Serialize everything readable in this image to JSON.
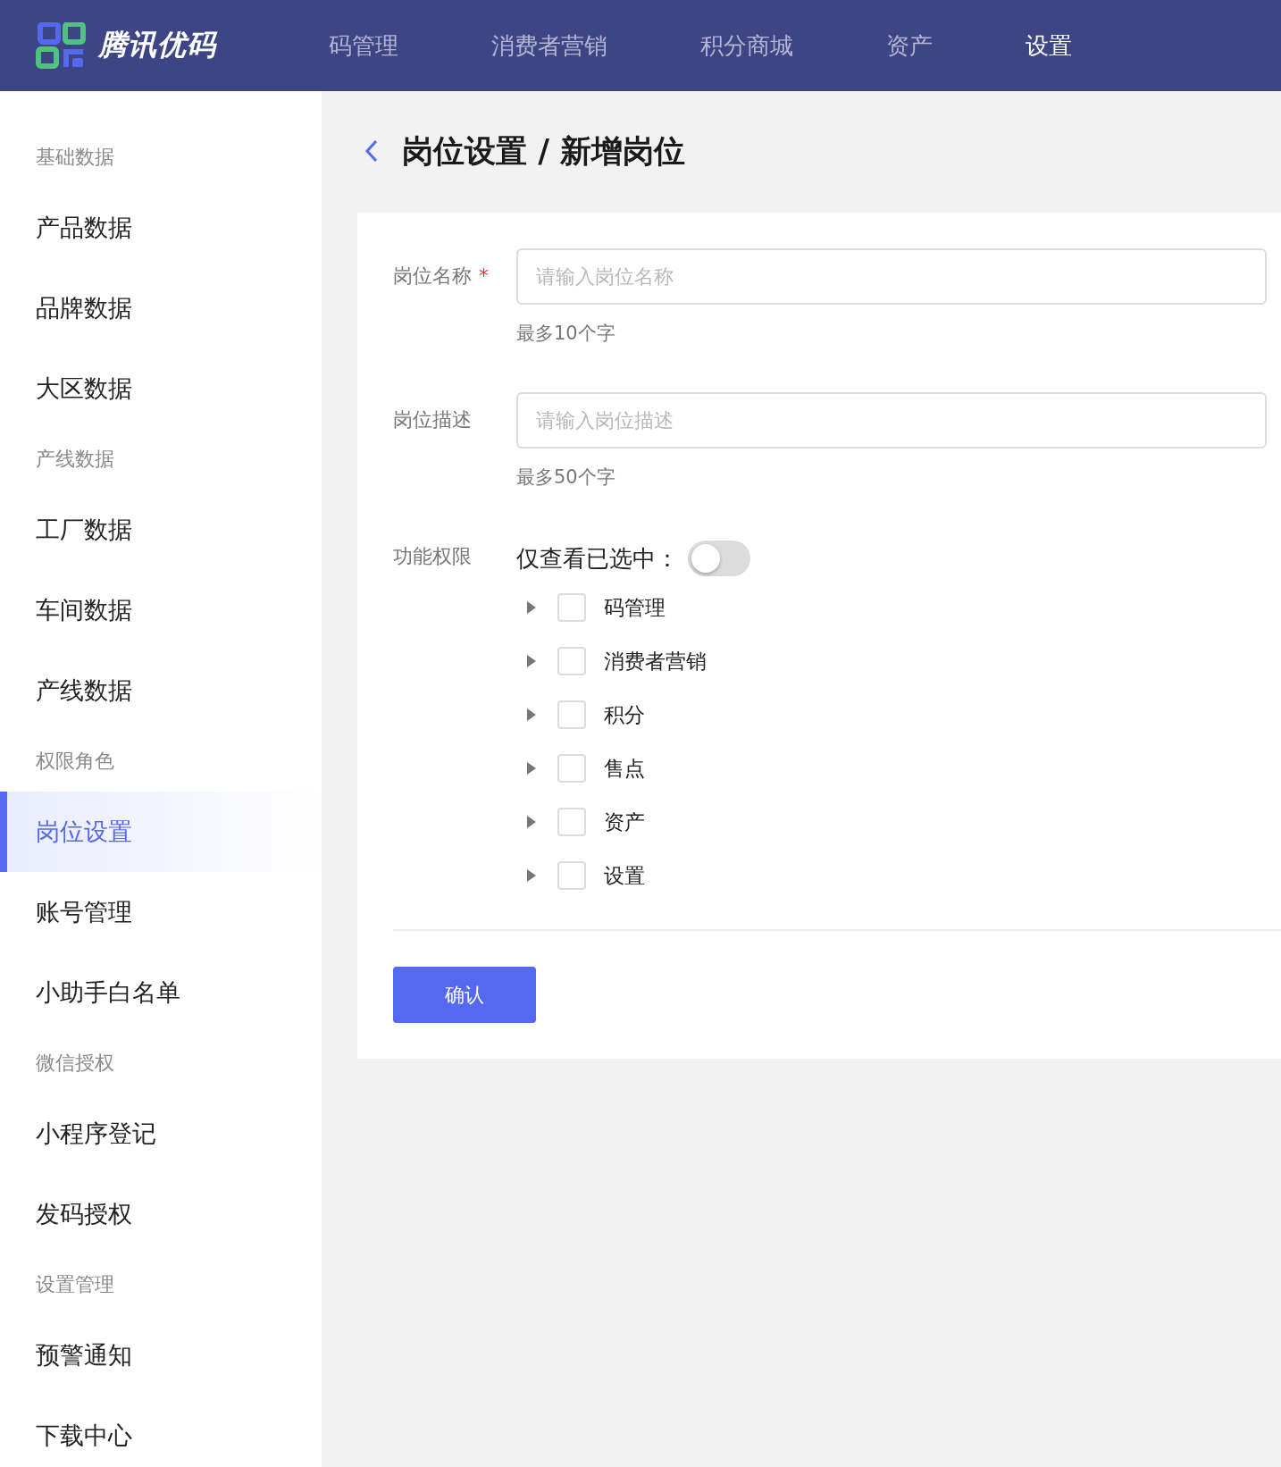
{
  "brand": {
    "name": "腾讯优码"
  },
  "nav": [
    {
      "label": "码管理",
      "selected": false
    },
    {
      "label": "消费者营销",
      "selected": false
    },
    {
      "label": "积分商城",
      "selected": false
    },
    {
      "label": "资产",
      "selected": false
    },
    {
      "label": "设置",
      "selected": true
    }
  ],
  "sidebar": [
    {
      "group": "基础数据",
      "items": [
        {
          "label": "产品数据",
          "selected": false
        },
        {
          "label": "品牌数据",
          "selected": false
        },
        {
          "label": "大区数据",
          "selected": false
        }
      ]
    },
    {
      "group": "产线数据",
      "items": [
        {
          "label": "工厂数据",
          "selected": false
        },
        {
          "label": "车间数据",
          "selected": false
        },
        {
          "label": "产线数据",
          "selected": false
        }
      ]
    },
    {
      "group": "权限角色",
      "items": [
        {
          "label": "岗位设置",
          "selected": true
        },
        {
          "label": "账号管理",
          "selected": false
        },
        {
          "label": "小助手白名单",
          "selected": false
        }
      ]
    },
    {
      "group": "微信授权",
      "items": [
        {
          "label": "小程序登记",
          "selected": false
        },
        {
          "label": "发码授权",
          "selected": false
        }
      ]
    },
    {
      "group": "设置管理",
      "items": [
        {
          "label": "预警通知",
          "selected": false
        },
        {
          "label": "下载中心",
          "selected": false
        }
      ]
    }
  ],
  "breadcrumb": "岗位设置 / 新增岗位",
  "fields": [
    {
      "label": "岗位名称",
      "required_mark": "*",
      "placeholder": "请输入岗位名称",
      "hint": "最多10个字"
    },
    {
      "label": "岗位描述",
      "placeholder": "请输入岗位描述",
      "hint": "最多50个字"
    }
  ],
  "permissions": {
    "label": "功能权限",
    "filter_label": "仅查看已选中：",
    "filter_on": false,
    "tree": [
      {
        "label": "码管理",
        "checked": false,
        "expanded": false
      },
      {
        "label": "消费者营销",
        "checked": false,
        "expanded": false
      },
      {
        "label": "积分",
        "checked": false,
        "expanded": false
      },
      {
        "label": "售点",
        "checked": false,
        "expanded": false
      },
      {
        "label": "资产",
        "checked": false,
        "expanded": false
      },
      {
        "label": "设置",
        "checked": false,
        "expanded": false
      }
    ]
  },
  "submit": "确认"
}
